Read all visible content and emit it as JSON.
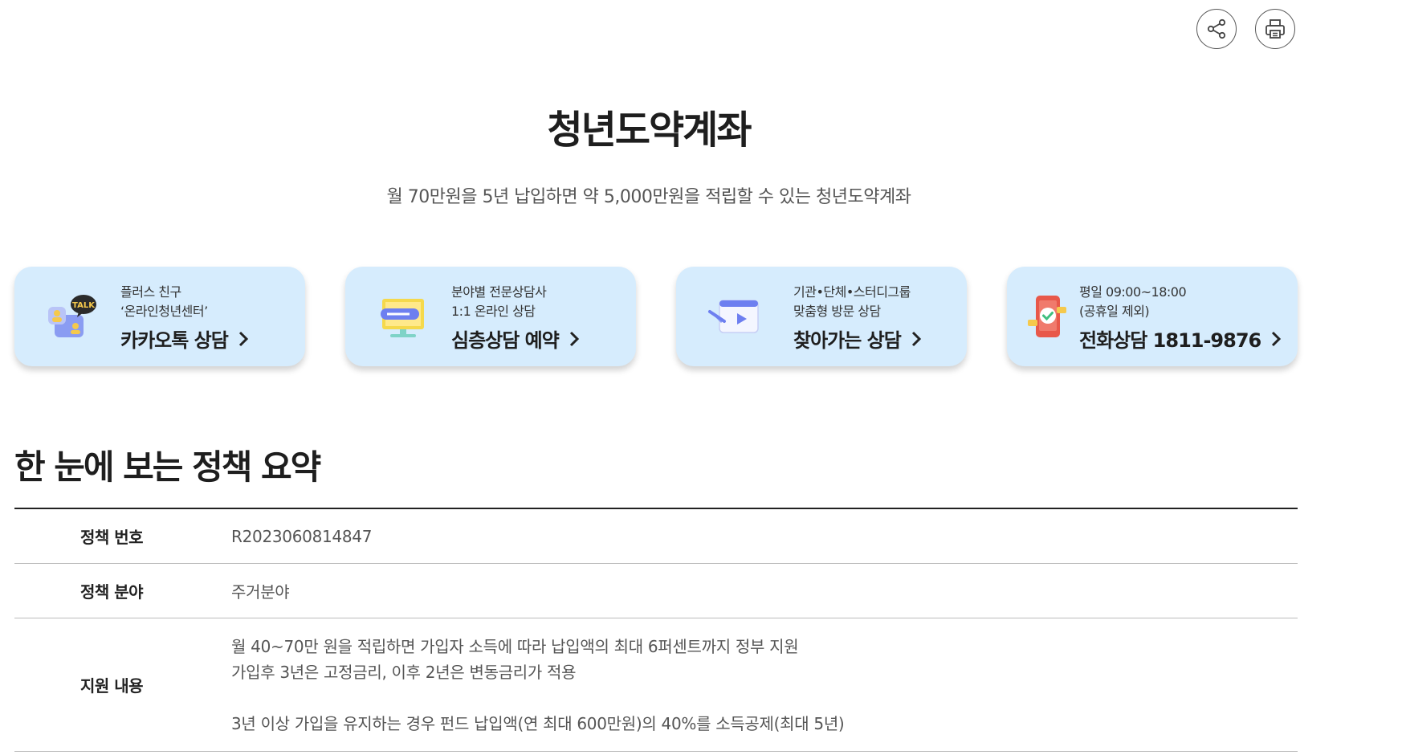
{
  "title": "청년도약계좌",
  "subtitle": "월 70만원을 5년 납입하면 약 5,000만원을 적립할 수 있는 청년도약계좌",
  "actions": {
    "share_icon": "share-icon",
    "print_icon": "print-icon"
  },
  "consult_cards": [
    {
      "line1": "플러스 친구",
      "line2": "‘온라인청년센터’",
      "label": "카카오톡 상담",
      "icon": "kakaotalk-icon"
    },
    {
      "line1": "분야별 전문상담사",
      "line2": "1:1 온라인 상담",
      "label": "심층상담 예약",
      "icon": "monitor-chat-icon"
    },
    {
      "line1": "기관•단체•스터디그룹",
      "line2": "맞춤형 방문 상담",
      "label": "찾아가는 상담",
      "icon": "video-visit-icon"
    },
    {
      "line1": "평일 09:00~18:00",
      "line2": "(공휴일 제외)",
      "label": "전화상담 1811-9876",
      "icon": "phone-icon"
    }
  ],
  "section_title": "한 눈에 보는 정책 요약",
  "summary": {
    "rows": [
      {
        "label": "정책 번호",
        "value": "R2023060814847"
      },
      {
        "label": "정책 분야",
        "value": "주거분야"
      },
      {
        "label": "지원 내용",
        "lines": [
          "월 40~70만 원을 적립하면 가입자 소득에 따라 납입액의 최대 6퍼센트까지 정부 지원",
          "가입후 3년은 고정금리, 이후 2년은 변동금리가 적용",
          "",
          "3년 이상 가입을 유지하는 경우 펀드 납입액(연 최대 600만원)의 40%를 소득공제(최대 5년)"
        ]
      }
    ]
  },
  "colors": {
    "card_bg": "#d6ecfd",
    "title": "#1e1e1e",
    "body_text": "#555555"
  }
}
